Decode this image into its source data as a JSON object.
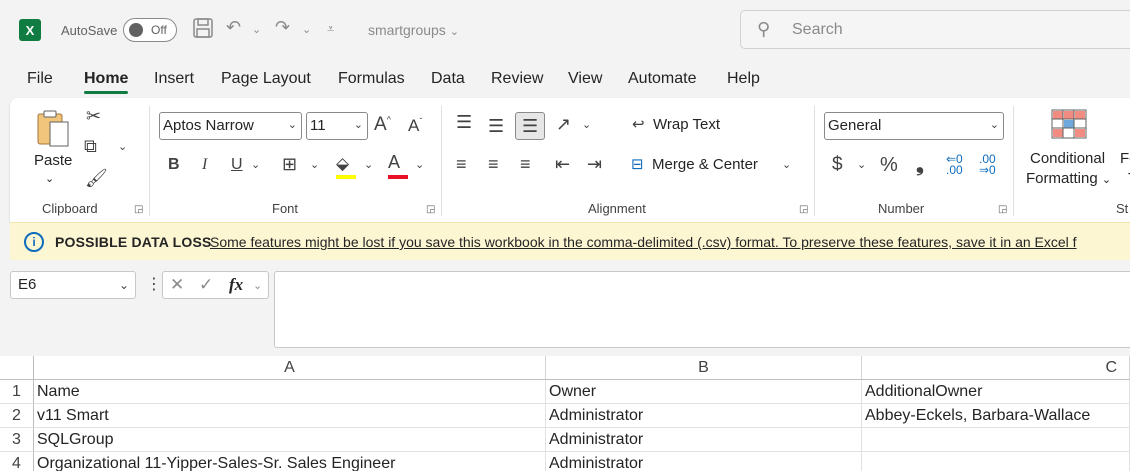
{
  "titlebar": {
    "app_icon": "excel-logo",
    "app_letter": "X",
    "autosave_label": "AutoSave",
    "autosave_state": "Off",
    "filename": "smartgroups",
    "search_placeholder": "Search"
  },
  "tabs": [
    "File",
    "Home",
    "Insert",
    "Page Layout",
    "Formulas",
    "Data",
    "Review",
    "View",
    "Automate",
    "Help"
  ],
  "active_tab": "Home",
  "ribbon": {
    "clipboard": {
      "paste_label": "Paste",
      "group_label": "Clipboard"
    },
    "font": {
      "font_name": "Aptos Narrow",
      "font_size": "11",
      "bold": "B",
      "italic": "I",
      "underline": "U",
      "group_label": "Font"
    },
    "alignment": {
      "wrap_text": "Wrap Text",
      "merge_center": "Merge & Center",
      "group_label": "Alignment"
    },
    "number": {
      "format": "General",
      "currency": "$",
      "percent": "%",
      "comma": "❟",
      "group_label": "Number"
    },
    "styles": {
      "conditional_line1": "Conditional",
      "conditional_line2": "Formatting",
      "next_partial_1": "Fo",
      "next_partial_2": "T",
      "group_label": "St"
    }
  },
  "infobar": {
    "title": "POSSIBLE DATA LOSS",
    "message": "Some features might be lost if you save this workbook in the comma-delimited (.csv) format. To preserve these features, save it in an Excel f"
  },
  "formula_bar": {
    "name_box": "E6",
    "fx": "fx",
    "value": ""
  },
  "sheet": {
    "columns": [
      "A",
      "B",
      "C"
    ],
    "rows": [
      {
        "num": "1",
        "cells": [
          "Name",
          "Owner",
          "AdditionalOwner"
        ]
      },
      {
        "num": "2",
        "cells": [
          "v11 Smart",
          "Administrator",
          "Abbey-Eckels, Barbara-Wallace"
        ]
      },
      {
        "num": "3",
        "cells": [
          "SQLGroup",
          "Administrator",
          ""
        ]
      },
      {
        "num": "4",
        "cells": [
          "Organizational 11-Yipper-Sales-Sr. Sales Engineer",
          "Administrator",
          ""
        ]
      }
    ]
  },
  "colors": {
    "brand": "#107c41",
    "info_bar_bg": "#fdf6d3",
    "info_icon": "#0f6cbd",
    "font_color_bar": "#e81123",
    "highlight_bar": "#ffff00"
  }
}
